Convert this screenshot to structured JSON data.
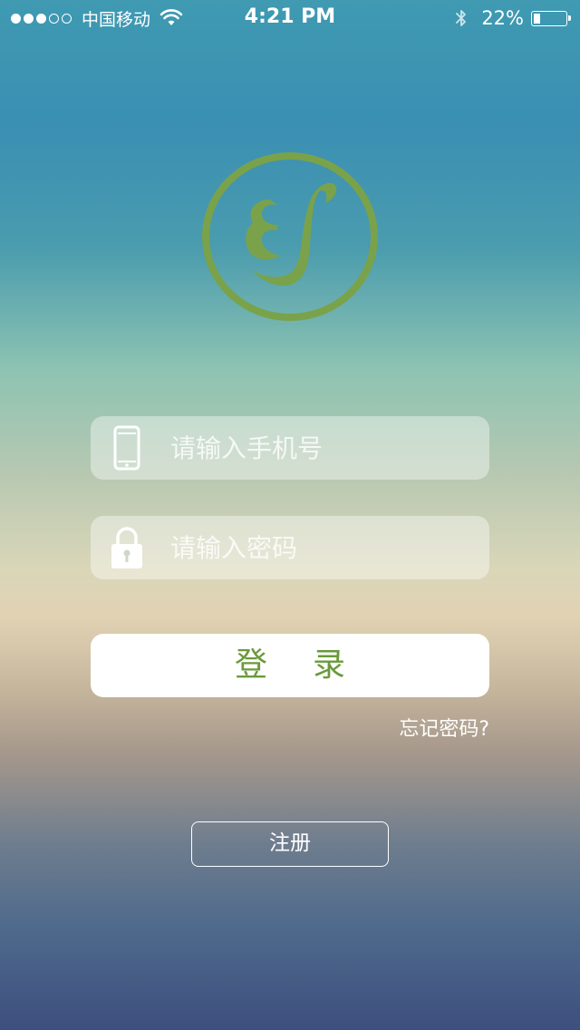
{
  "status_bar": {
    "carrier": "中国移动",
    "time": "4:21 PM",
    "battery_percent": "22%",
    "battery_level": 0.22,
    "signal_bars_filled": 3,
    "signal_bars_total": 5
  },
  "logo": {
    "icon": "brand-logo-icon",
    "color": "#7aa24a"
  },
  "form": {
    "phone": {
      "placeholder": "请输入手机号",
      "value": "",
      "icon": "phone-icon"
    },
    "password": {
      "placeholder": "请输入密码",
      "value": "",
      "icon": "lock-icon"
    },
    "login_label": "登录",
    "forgot_label": "忘记密码?",
    "register_label": "注册"
  },
  "colors": {
    "accent": "#6a9a3a"
  }
}
